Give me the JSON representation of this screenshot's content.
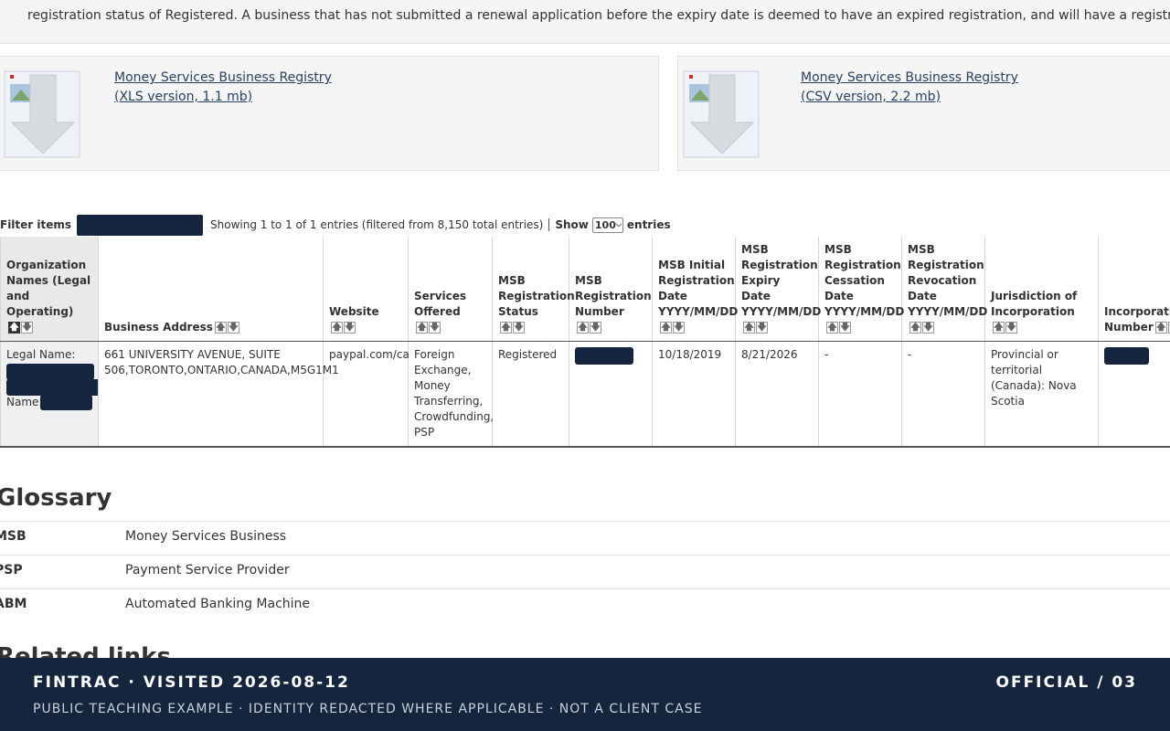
{
  "intro": {
    "text": "registration status of Registered. A business that has not submitted a renewal application before the expiry date is deemed to have an expired registration, and will have a registration status of Expired."
  },
  "downloads": [
    {
      "line1": "Money Services Business Registry",
      "line2": "(XLS version, 1.1 mb)"
    },
    {
      "line1": "Money Services Business Registry",
      "line2": "(CSV version, 2.2 mb)"
    }
  ],
  "controls": {
    "filter_label": "Filter items",
    "info": "Showing 1 to 1 of 1 entries (filtered from 8,150 total entries)",
    "show_label": "Show",
    "show_value": "100",
    "entries_label": "entries"
  },
  "table": {
    "headers": [
      "Organization Names (Legal and Operating)",
      "Business Address",
      "Website",
      "Services Offered",
      "MSB Registration Status",
      "MSB Registration Number",
      "MSB Initial Registration Date YYYY/MM/DD",
      "MSB Registration Expiry Date YYYY/MM/DD",
      "MSB Registration Cessation Date YYYY/MM/DD",
      "MSB Registration Revocation Date YYYY/MM/DD",
      "Jurisdiction of Incorporation",
      "Incorporation Number"
    ],
    "row": {
      "legal_label": "Legal Name:",
      "name_label": "Name:",
      "address": "661 UNIVERSITY AVENUE, SUITE 506,TORONTO,ONTARIO,CANADA,M5G1M1",
      "website": "paypal.com/ca",
      "services": "Foreign Exchange, Money Transferring, Crowdfunding, PSP",
      "status": "Registered",
      "initial_date": "10/18/2019",
      "expiry_date": "8/21/2026",
      "cessation_date": "-",
      "revocation_date": "-",
      "jurisdiction": "Provincial or territorial (Canada): Nova Scotia"
    }
  },
  "glossary": {
    "title": "Glossary",
    "items": [
      {
        "term": "MSB",
        "definition": "Money Services Business"
      },
      {
        "term": "PSP",
        "definition": "Payment Service Provider"
      },
      {
        "term": "ABM",
        "definition": "Automated Banking Machine"
      }
    ]
  },
  "related": {
    "title": "Related links"
  },
  "footer": {
    "title": "FINTRAC · VISITED 2026-08-12",
    "right": "OFFICIAL / 03",
    "subtitle": "PUBLIC TEACHING EXAMPLE · IDENTITY REDACTED WHERE APPLICABLE · NOT A CLIENT CASE"
  },
  "colors": {
    "link": "#284162",
    "redaction": "#14253d",
    "footer_bg": "#14253d"
  }
}
